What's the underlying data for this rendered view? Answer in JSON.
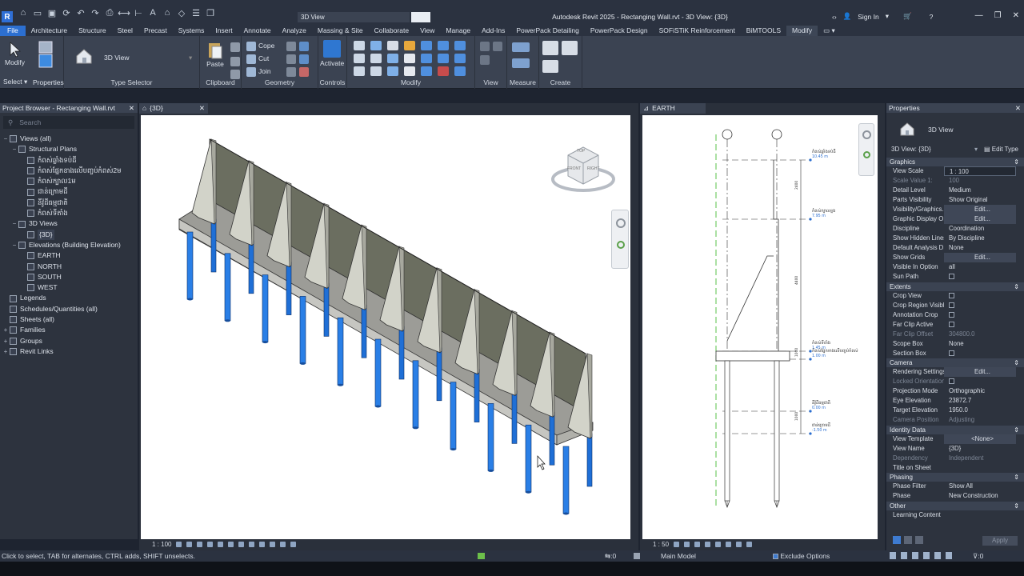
{
  "title_bar": {
    "app_title": "Autodesk Revit 2025 - Rectanging Wall.rvt - 3D View: {3D}",
    "view_dropdown": "3D View",
    "sign_in": "Sign In"
  },
  "menu_tabs": [
    "File",
    "Architecture",
    "Structure",
    "Steel",
    "Precast",
    "Systems",
    "Insert",
    "Annotate",
    "Analyze",
    "Massing & Site",
    "Collaborate",
    "View",
    "Manage",
    "Add-Ins",
    "PowerPack Detailing",
    "PowerPack Design",
    "SOFiSTiK Reinforcement",
    "BiMTOOLS",
    "Modify"
  ],
  "ribbon": {
    "modify_btn": "Modify",
    "select_label": "Select",
    "properties_label": "Properties",
    "type_selector_value": "3D View",
    "type_selector_label": "Type Selector",
    "paste_btn": "Paste",
    "clipboard_label": "Clipboard",
    "cope_btn": "Cope",
    "cut_btn": "Cut",
    "join_btn": "Join",
    "geometry_label": "Geometry",
    "activate_btn": "Activate",
    "controls_label": "Controls",
    "modify_label": "Modify",
    "view_label": "View",
    "measure_label": "Measure",
    "create_label": "Create"
  },
  "project_browser": {
    "title": "Project Browser - Rectanging Wall.rvt",
    "search_placeholder": "Search",
    "nodes": [
      {
        "label": "Views (all)",
        "level": 0,
        "toggle": "−"
      },
      {
        "label": "Structural Plans",
        "level": 1,
        "toggle": "−"
      },
      {
        "label": "កំពស់ឆ្លាំងទប់ដី",
        "level": 2,
        "toggle": ""
      },
      {
        "label": "កំពស់ផ្នែកខាងលើបញ្ចប់កំពស់2ម",
        "level": 2,
        "toggle": ""
      },
      {
        "label": "កំពស់ក្បាល1ម",
        "level": 2,
        "toggle": ""
      },
      {
        "label": "ជាន់ក្រោមដី",
        "level": 2,
        "toggle": ""
      },
      {
        "label": "នីវ៉ូដីធម្មជាតិ",
        "level": 2,
        "toggle": ""
      },
      {
        "label": "កំពស់ទីតាំង",
        "level": 2,
        "toggle": ""
      },
      {
        "label": "3D Views",
        "level": 1,
        "toggle": "−"
      },
      {
        "label": "{3D}",
        "level": 2,
        "toggle": "",
        "selected": true
      },
      {
        "label": "Elevations (Building Elevation)",
        "level": 1,
        "toggle": "−"
      },
      {
        "label": "EARTH",
        "level": 2,
        "toggle": ""
      },
      {
        "label": "NORTH",
        "level": 2,
        "toggle": ""
      },
      {
        "label": "SOUTH",
        "level": 2,
        "toggle": ""
      },
      {
        "label": "WEST",
        "level": 2,
        "toggle": ""
      },
      {
        "label": "Legends",
        "level": 0,
        "toggle": ""
      },
      {
        "label": "Schedules/Quantities (all)",
        "level": 0,
        "toggle": ""
      },
      {
        "label": "Sheets (all)",
        "level": 0,
        "toggle": ""
      },
      {
        "label": "Families",
        "level": 0,
        "toggle": "+"
      },
      {
        "label": "Groups",
        "level": 0,
        "toggle": "+"
      },
      {
        "label": "Revit Links",
        "level": 0,
        "toggle": "+"
      }
    ]
  },
  "view1": {
    "tab": "{3D}",
    "scale": "1 : 100",
    "viewcube_top": "TOP",
    "viewcube_front": "FRONT",
    "viewcube_right": "RIGHT"
  },
  "view2": {
    "tab": "EARTH",
    "scale": "1 : 50",
    "levels": [
      {
        "name": "កំពស់ឆ្លាំងទប់ដី",
        "elev": "10.45 m"
      },
      {
        "name": "កំពស់ក្បាលខ្នង",
        "elev": "7.95 m"
      },
      {
        "name": "កំពស់ទីតាំង",
        "elev": "1.45 m"
      },
      {
        "name": "កំពស់ផ្នែកខាងលើបញ្ចប់កំពស់",
        "elev": "1.00 m"
      },
      {
        "name": "នីវ៉ូដីធម្មជាតិ",
        "elev": "0.00 m"
      },
      {
        "name": "ជាន់ក្រោមដី",
        "elev": "-1.50 m"
      }
    ],
    "dims": [
      "2400",
      "4400",
      "1000",
      "1000"
    ]
  },
  "properties": {
    "title": "Properties",
    "type_name": "3D View",
    "selector": "3D View: {3D}",
    "edit_type": "Edit Type",
    "groups": [
      {
        "name": "Graphics",
        "rows": [
          {
            "k": "View Scale",
            "v": "1 : 100",
            "style": "box"
          },
          {
            "k": "Scale Value 1:",
            "v": "100",
            "style": "dis"
          },
          {
            "k": "Detail Level",
            "v": "Medium"
          },
          {
            "k": "Parts Visibility",
            "v": "Show Original"
          },
          {
            "k": "Visibility/Graphics...",
            "v": "Edit...",
            "style": "edit"
          },
          {
            "k": "Graphic Display O...",
            "v": "Edit...",
            "style": "edit"
          },
          {
            "k": "Discipline",
            "v": "Coordination"
          },
          {
            "k": "Show Hidden Lines",
            "v": "By Discipline"
          },
          {
            "k": "Default Analysis D...",
            "v": "None"
          },
          {
            "k": "Show Grids",
            "v": "Edit...",
            "style": "edit"
          },
          {
            "k": "Visible In Option",
            "v": "all"
          },
          {
            "k": "Sun Path",
            "v": "",
            "style": "chk"
          }
        ]
      },
      {
        "name": "Extents",
        "rows": [
          {
            "k": "Crop View",
            "v": "",
            "style": "chk"
          },
          {
            "k": "Crop Region Visible",
            "v": "",
            "style": "chk"
          },
          {
            "k": "Annotation Crop",
            "v": "",
            "style": "chk"
          },
          {
            "k": "Far Clip Active",
            "v": "",
            "style": "chk"
          },
          {
            "k": "Far Clip Offset",
            "v": "304800.0",
            "style": "dis"
          },
          {
            "k": "Scope Box",
            "v": "None"
          },
          {
            "k": "Section Box",
            "v": "",
            "style": "chk"
          }
        ]
      },
      {
        "name": "Camera",
        "rows": [
          {
            "k": "Rendering Settings",
            "v": "Edit...",
            "style": "edit"
          },
          {
            "k": "Locked Orientation",
            "v": "",
            "style": "chkdis"
          },
          {
            "k": "Projection Mode",
            "v": "Orthographic"
          },
          {
            "k": "Eye Elevation",
            "v": "23872.7"
          },
          {
            "k": "Target Elevation",
            "v": "1950.0"
          },
          {
            "k": "Camera Position",
            "v": "Adjusting",
            "style": "dis"
          }
        ]
      },
      {
        "name": "Identity Data",
        "rows": [
          {
            "k": "View Template",
            "v": "<None>",
            "style": "edit"
          },
          {
            "k": "View Name",
            "v": "{3D}"
          },
          {
            "k": "Dependency",
            "v": "Independent",
            "style": "dis"
          },
          {
            "k": "Title on Sheet",
            "v": ""
          }
        ]
      },
      {
        "name": "Phasing",
        "rows": [
          {
            "k": "Phase Filter",
            "v": "Show All"
          },
          {
            "k": "Phase",
            "v": "New Construction"
          }
        ]
      },
      {
        "name": "Other",
        "rows": [
          {
            "k": "Learning Content",
            "v": ""
          }
        ]
      }
    ],
    "apply": "Apply"
  },
  "status_bar": {
    "hint": "Click to select, TAB for alternates, CTRL adds, SHIFT unselects.",
    "model": "Main Model",
    "exclude": "Exclude Options",
    "coord": ":0",
    "filter_count": ":0"
  },
  "colors": {
    "accent": "#2c6fd0",
    "pile": "#1f6fd6",
    "wall": "#6b6e60"
  }
}
